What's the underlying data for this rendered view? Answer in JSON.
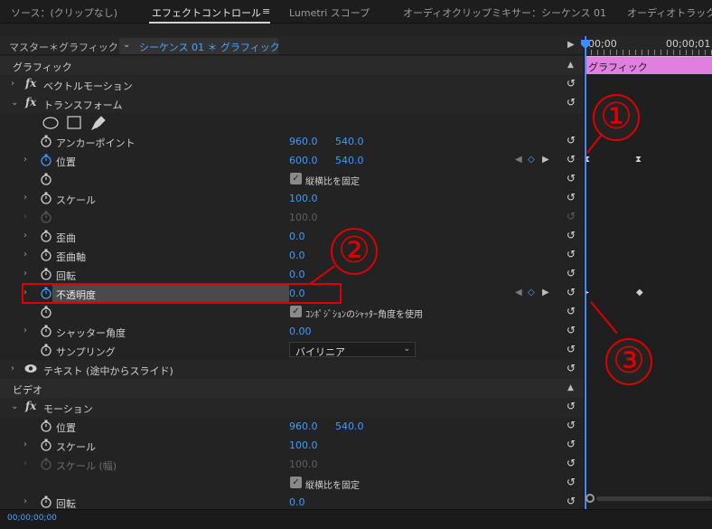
{
  "tabs": [
    {
      "label": "ソース：(クリップなし)",
      "active": false
    },
    {
      "label": "エフェクトコントロール",
      "active": true
    },
    {
      "label": "Lumetri スコープ",
      "active": false
    },
    {
      "label": "オーディオクリップミキサー：シーケンス 01",
      "active": false
    },
    {
      "label": "オーディオトラックミ",
      "active": false
    }
  ],
  "tab_menu_icon": "≡",
  "header": {
    "master": "マスター＊グラフィック",
    "sequence": "シーケンス 01 ＊ グラフィック"
  },
  "rows": {
    "graphic_section": "グラフィック",
    "vector_motion": "ベクトルモーション",
    "transform": "トランスフォーム",
    "anchor_point": {
      "label": "アンカーポイント",
      "x": "960.0",
      "y": "540.0"
    },
    "position": {
      "label": "位置",
      "x": "600.0",
      "y": "540.0"
    },
    "uniform_scale": "縦横比を固定",
    "scale": {
      "label": "スケール",
      "value": "100.0"
    },
    "scale_width": {
      "value": "100.0"
    },
    "skew": {
      "label": "歪曲",
      "value": "0.0"
    },
    "skew_axis": {
      "label": "歪曲軸",
      "value": "0.0"
    },
    "rotation": {
      "label": "回転",
      "value": "0.0"
    },
    "opacity": {
      "label": "不透明度",
      "value": "0.0"
    },
    "use_comp_shutter": "ｺﾝﾎﾟｼﾞｼｮﾝのｼｬｯﾀｰ角度を使用",
    "shutter_angle": {
      "label": "シャッター角度",
      "value": "0.00"
    },
    "sampling": {
      "label": "サンプリング",
      "value": "バイリニア"
    },
    "text_layer": "テキスト (途中からスライド)",
    "video_section": "ビデオ",
    "motion": "モーション",
    "motion_position": {
      "label": "位置",
      "x": "960.0",
      "y": "540.0"
    },
    "motion_scale": {
      "label": "スケール",
      "value": "100.0"
    },
    "motion_scale_width": {
      "label": "スケール (幅)",
      "value": "100.0"
    },
    "motion_uniform_scale": "縦横比を固定",
    "motion_rotation": {
      "label": "回転",
      "value": "0.0"
    }
  },
  "timeline": {
    "t0": "00;00",
    "t1": "00;00;01",
    "clip_label": "グラフィック"
  },
  "timecode": "00;00;00;00",
  "annotations": [
    "①",
    "②",
    "③"
  ],
  "colors": {
    "accent": "#3f9bff",
    "annotation": "#e00000",
    "clip": "#e07fe0"
  }
}
